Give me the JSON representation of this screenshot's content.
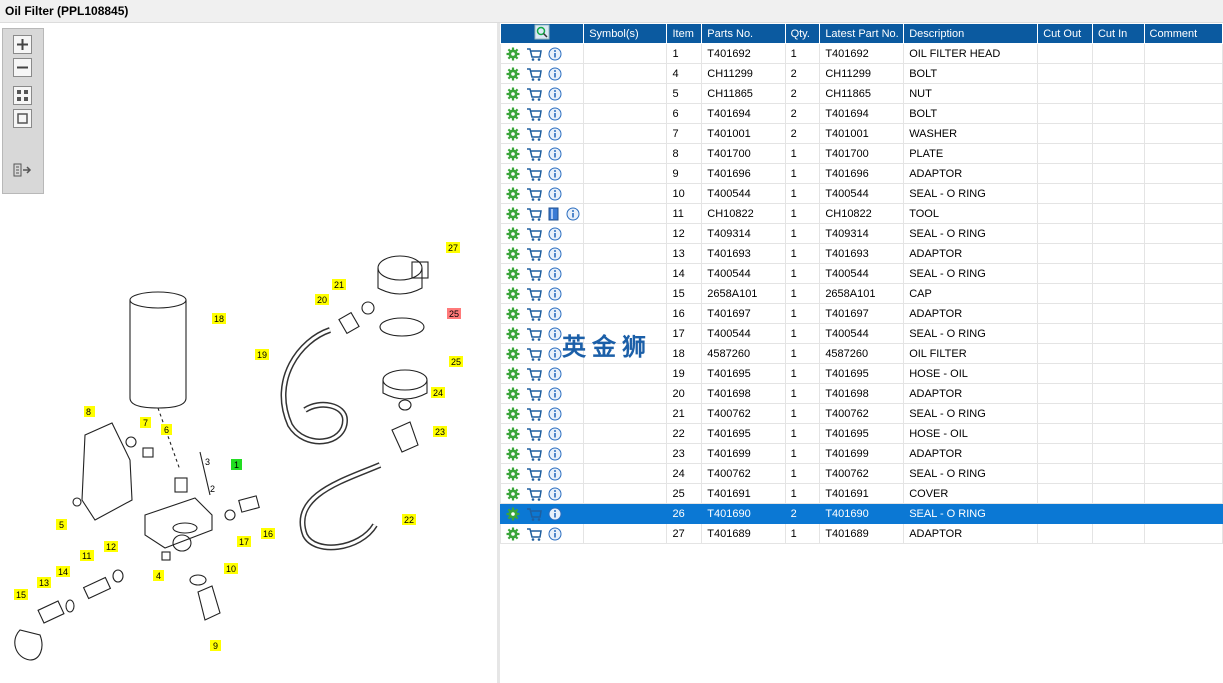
{
  "window": {
    "title": "Oil Filter (PPL108845)"
  },
  "table": {
    "columns": [
      "Symbol(s)",
      "Item",
      "Parts No.",
      "Qty.",
      "Latest Part No.",
      "Description",
      "Cut Out",
      "Cut In",
      "Comment"
    ],
    "rows": [
      {
        "item": "1",
        "part_no": "T401692",
        "qty": "1",
        "latest": "T401692",
        "desc": "OIL FILTER HEAD",
        "cut_out": "",
        "cut_in": "",
        "comment": ""
      },
      {
        "item": "4",
        "part_no": "CH11299",
        "qty": "2",
        "latest": "CH11299",
        "desc": "BOLT",
        "cut_out": "",
        "cut_in": "",
        "comment": ""
      },
      {
        "item": "5",
        "part_no": "CH11865",
        "qty": "2",
        "latest": "CH11865",
        "desc": "NUT",
        "cut_out": "",
        "cut_in": "",
        "comment": ""
      },
      {
        "item": "6",
        "part_no": "T401694",
        "qty": "2",
        "latest": "T401694",
        "desc": "BOLT",
        "cut_out": "",
        "cut_in": "",
        "comment": ""
      },
      {
        "item": "7",
        "part_no": "T401001",
        "qty": "2",
        "latest": "T401001",
        "desc": "WASHER",
        "cut_out": "",
        "cut_in": "",
        "comment": ""
      },
      {
        "item": "8",
        "part_no": "T401700",
        "qty": "1",
        "latest": "T401700",
        "desc": "PLATE",
        "cut_out": "",
        "cut_in": "",
        "comment": ""
      },
      {
        "item": "9",
        "part_no": "T401696",
        "qty": "1",
        "latest": "T401696",
        "desc": "ADAPTOR",
        "cut_out": "",
        "cut_in": "",
        "comment": ""
      },
      {
        "item": "10",
        "part_no": "T400544",
        "qty": "1",
        "latest": "T400544",
        "desc": "SEAL - O RING",
        "cut_out": "",
        "cut_in": "",
        "comment": ""
      },
      {
        "item": "11",
        "part_no": "CH10822",
        "qty": "1",
        "latest": "CH10822",
        "desc": "TOOL",
        "cut_out": "",
        "cut_in": "",
        "comment": ""
      },
      {
        "item": "12",
        "part_no": "T409314",
        "qty": "1",
        "latest": "T409314",
        "desc": "SEAL - O RING",
        "cut_out": "",
        "cut_in": "",
        "comment": ""
      },
      {
        "item": "13",
        "part_no": "T401693",
        "qty": "1",
        "latest": "T401693",
        "desc": "ADAPTOR",
        "cut_out": "",
        "cut_in": "",
        "comment": ""
      },
      {
        "item": "14",
        "part_no": "T400544",
        "qty": "1",
        "latest": "T400544",
        "desc": "SEAL - O RING",
        "cut_out": "",
        "cut_in": "",
        "comment": ""
      },
      {
        "item": "15",
        "part_no": "2658A101",
        "qty": "1",
        "latest": "2658A101",
        "desc": "CAP",
        "cut_out": "",
        "cut_in": "",
        "comment": ""
      },
      {
        "item": "16",
        "part_no": "T401697",
        "qty": "1",
        "latest": "T401697",
        "desc": "ADAPTOR",
        "cut_out": "",
        "cut_in": "",
        "comment": ""
      },
      {
        "item": "17",
        "part_no": "T400544",
        "qty": "1",
        "latest": "T400544",
        "desc": "SEAL - O RING",
        "cut_out": "",
        "cut_in": "",
        "comment": ""
      },
      {
        "item": "18",
        "part_no": "4587260",
        "qty": "1",
        "latest": "4587260",
        "desc": "OIL FILTER",
        "cut_out": "",
        "cut_in": "",
        "comment": ""
      },
      {
        "item": "19",
        "part_no": "T401695",
        "qty": "1",
        "latest": "T401695",
        "desc": "HOSE - OIL",
        "cut_out": "",
        "cut_in": "",
        "comment": ""
      },
      {
        "item": "20",
        "part_no": "T401698",
        "qty": "1",
        "latest": "T401698",
        "desc": "ADAPTOR",
        "cut_out": "",
        "cut_in": "",
        "comment": ""
      },
      {
        "item": "21",
        "part_no": "T400762",
        "qty": "1",
        "latest": "T400762",
        "desc": "SEAL - O RING",
        "cut_out": "",
        "cut_in": "",
        "comment": ""
      },
      {
        "item": "22",
        "part_no": "T401695",
        "qty": "1",
        "latest": "T401695",
        "desc": "HOSE - OIL",
        "cut_out": "",
        "cut_in": "",
        "comment": ""
      },
      {
        "item": "23",
        "part_no": "T401699",
        "qty": "1",
        "latest": "T401699",
        "desc": "ADAPTOR",
        "cut_out": "",
        "cut_in": "",
        "comment": ""
      },
      {
        "item": "24",
        "part_no": "T400762",
        "qty": "1",
        "latest": "T400762",
        "desc": "SEAL - O RING",
        "cut_out": "",
        "cut_in": "",
        "comment": ""
      },
      {
        "item": "25",
        "part_no": "T401691",
        "qty": "1",
        "latest": "T401691",
        "desc": "COVER",
        "cut_out": "",
        "cut_in": "",
        "comment": ""
      },
      {
        "item": "26",
        "part_no": "T401690",
        "qty": "2",
        "latest": "T401690",
        "desc": "SEAL - O RING",
        "cut_out": "",
        "cut_in": "",
        "comment": ""
      },
      {
        "item": "27",
        "part_no": "T401689",
        "qty": "1",
        "latest": "T401689",
        "desc": "ADAPTOR",
        "cut_out": "",
        "cut_in": "",
        "comment": ""
      }
    ]
  },
  "selected_item": "26",
  "tool_icon_item": "11",
  "watermark": "英金狮",
  "diagram": {
    "callouts": [
      "1",
      "2",
      "3",
      "4",
      "5",
      "6",
      "7",
      "8",
      "9",
      "10",
      "11",
      "12",
      "13",
      "14",
      "15",
      "16",
      "17",
      "18",
      "19",
      "20",
      "21",
      "22",
      "23",
      "24",
      "25",
      "25",
      "27"
    ]
  },
  "colors": {
    "header": "#0b5aa0",
    "selected_row": "#0b78d4",
    "callout_yellow": "#ffff00",
    "callout_green": "#22dd22",
    "callout_red": "#ff7a7a"
  },
  "icons": [
    "zoom-in-icon",
    "zoom-out-icon",
    "fit-view-icon",
    "reset-view-icon",
    "export-icon",
    "search-icon",
    "gear-icon",
    "cart-icon",
    "info-icon",
    "tool-book-icon"
  ]
}
